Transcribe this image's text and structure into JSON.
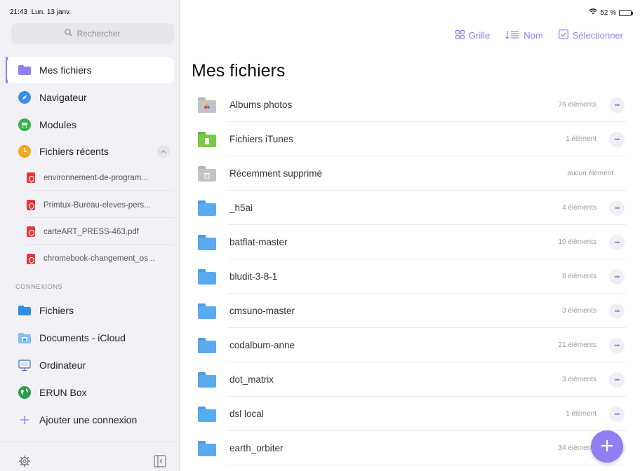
{
  "status": {
    "time": "21:43",
    "date": "Lun. 13 janv.",
    "battery": "52 %",
    "battery_level": 0.52
  },
  "sidebar": {
    "search_placeholder": "Rechercher",
    "items": [
      {
        "label": "Mes fichiers",
        "icon": "folder-icon"
      },
      {
        "label": "Navigateur",
        "icon": "compass-icon"
      },
      {
        "label": "Modules",
        "icon": "cart-icon"
      },
      {
        "label": "Fichiers récents",
        "icon": "clock-icon"
      }
    ],
    "recent_files": [
      "environnement-de-program...",
      "Primtux-Bureau-eleves-pers...",
      "carteART_PRESS-463.pdf",
      "chromebook-changement_os..."
    ],
    "connections_label": "CONNEXIONS",
    "connections": [
      {
        "label": "Fichiers",
        "icon": "folder-icon"
      },
      {
        "label": "Documents - iCloud",
        "icon": "cloud-folder-icon"
      },
      {
        "label": "Ordinateur",
        "icon": "computer-icon"
      },
      {
        "label": "ERUN Box",
        "icon": "globe-icon"
      },
      {
        "label": "Ajouter une connexion",
        "icon": "plus-icon"
      }
    ]
  },
  "toolbar": {
    "grid_label": "Grille",
    "sort_label": "Nom",
    "select_label": "Sélectionner"
  },
  "main": {
    "title": "Mes fichiers",
    "files": [
      {
        "name": "Albums photos",
        "count": "76 éléments",
        "kind": "photos"
      },
      {
        "name": "Fichiers iTunes",
        "count": "1 élément",
        "kind": "itunes"
      },
      {
        "name": "Récemment supprimé",
        "count": "aucun élément",
        "kind": "trash"
      },
      {
        "name": "_h5ai",
        "count": "4 éléments",
        "kind": "folder"
      },
      {
        "name": "batflat-master",
        "count": "10 éléments",
        "kind": "folder"
      },
      {
        "name": "bludit-3-8-1",
        "count": "8 éléments",
        "kind": "folder"
      },
      {
        "name": "cmsuno-master",
        "count": "3 éléments",
        "kind": "folder"
      },
      {
        "name": "codalbum-anne",
        "count": "21 éléments",
        "kind": "folder"
      },
      {
        "name": "dot_matrix",
        "count": "3 éléments",
        "kind": "folder"
      },
      {
        "name": "dsl local",
        "count": "1 élément",
        "kind": "folder"
      },
      {
        "name": "earth_orbiter",
        "count": "34 éléments",
        "kind": "folder"
      }
    ]
  },
  "colors": {
    "accent": "#8f7ff0",
    "folder_blue": "#5aaaf0",
    "folder_green": "#7ac94a",
    "folder_gray": "#c4c4c8"
  }
}
